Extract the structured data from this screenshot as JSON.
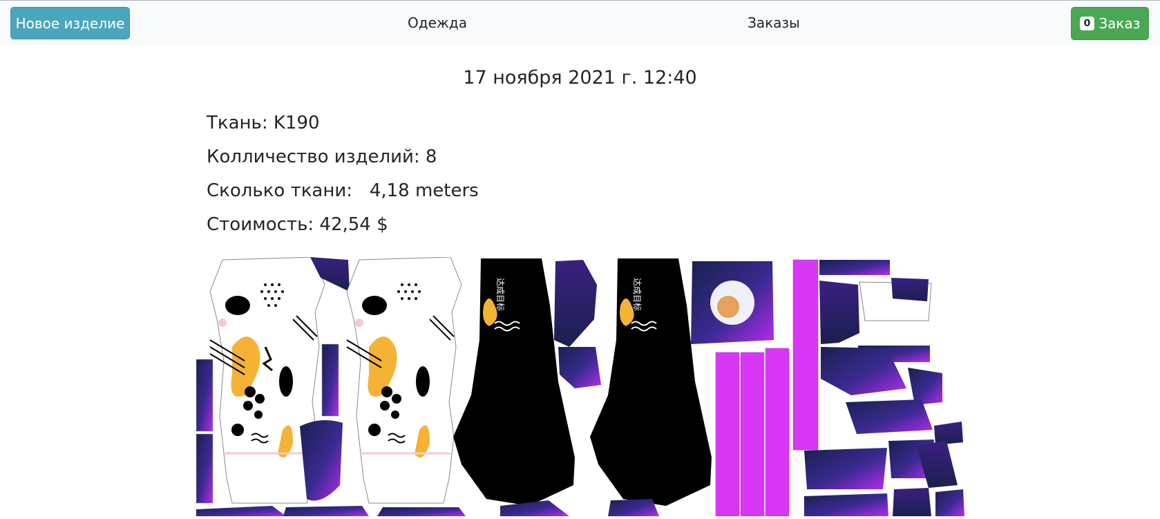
{
  "navbar": {
    "new_item_label": "Новое изделие",
    "clothes_label": "Одежда",
    "orders_label": "Заказы",
    "order_count": "0",
    "order_label": "Заказ"
  },
  "order": {
    "date": "17 ноября 2021 г. 12:40",
    "fabric": "Ткань: K190",
    "quantity": "Колличество изделий: 8",
    "fabric_amount": "Сколько ткани:   4,18 meters",
    "cost": "Стоимость: 42,54 $"
  },
  "pattern": {
    "colors": {
      "purple": "#a020f0",
      "navy": "#1a2050",
      "magenta": "#d838f5",
      "orange": "#f5b234",
      "black": "#000000"
    },
    "print_text": "达成目标"
  }
}
